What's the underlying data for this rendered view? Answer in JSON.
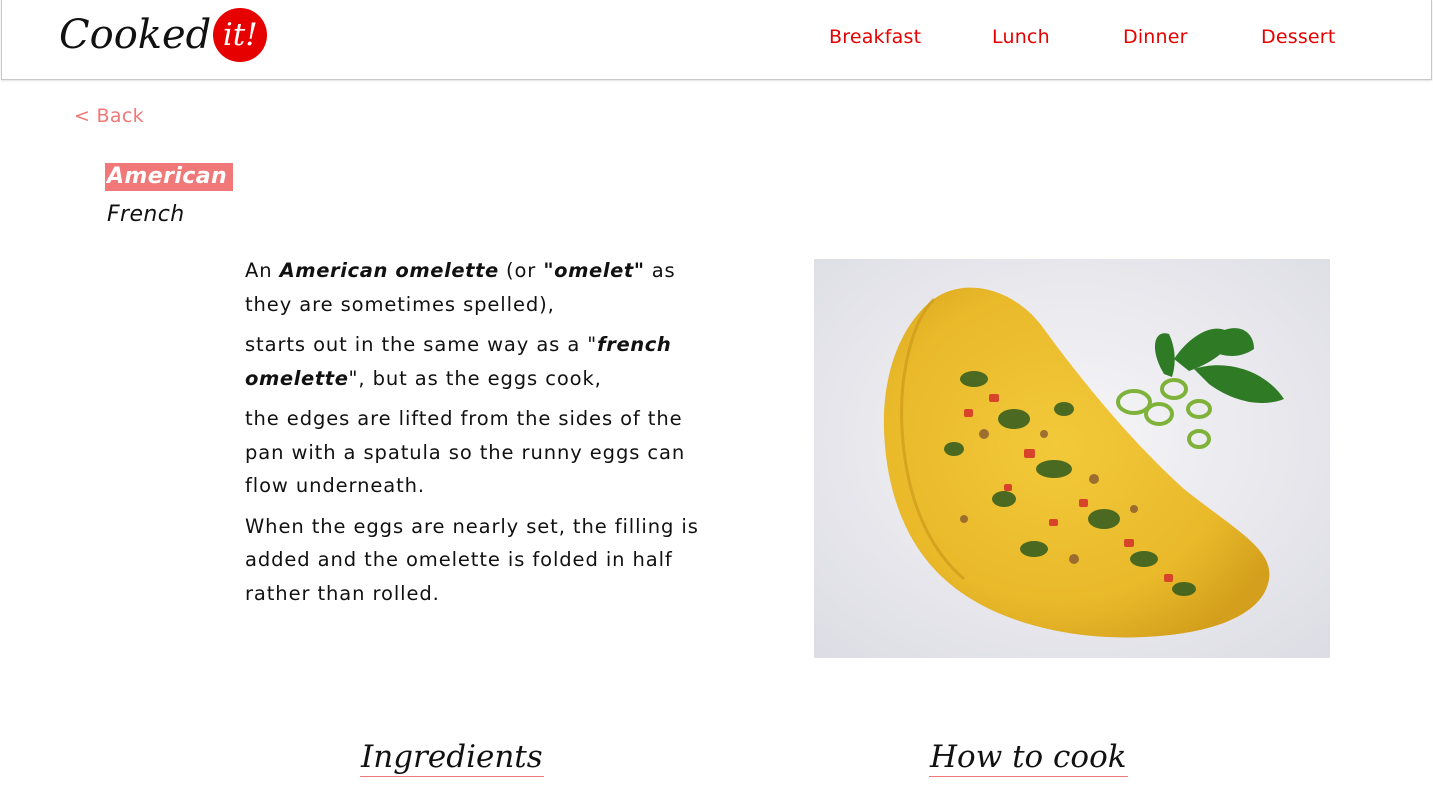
{
  "header": {
    "logo": {
      "main": "Cooked",
      "badge": "it!"
    },
    "nav": [
      {
        "label": "Breakfast"
      },
      {
        "label": "Lunch"
      },
      {
        "label": "Dinner"
      },
      {
        "label": "Dessert"
      }
    ]
  },
  "back_label": "< Back",
  "variants": [
    {
      "label": "American",
      "active": true
    },
    {
      "label": "French",
      "active": false
    }
  ],
  "description": {
    "p1": {
      "t1": "An ",
      "b1": "American omelette",
      "t2": " (or ",
      "b2": "\"omelet\"",
      "t3": " as they are sometimes spelled),"
    },
    "p2": {
      "t1": "starts out in the same way as a \"",
      "b1": "french omelette",
      "t2": "\", but as the eggs cook,"
    },
    "p3": "the edges are lifted from the sides of the pan with a spatula so the runny eggs can flow underneath.",
    "p4": "When the eggs are nearly set, the filling is added and the omelette is folded in half rather than rolled."
  },
  "photo": {
    "subject": "american-omelette-photo"
  },
  "sections": {
    "ingredients": "Ingredients",
    "how_to_cook": "How to cook"
  },
  "colors": {
    "brand_red": "#e60000",
    "accent_pink": "#f07878"
  }
}
